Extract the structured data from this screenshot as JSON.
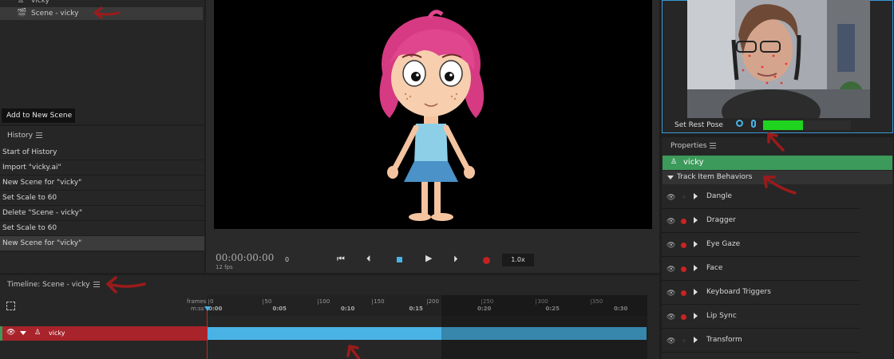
{
  "puppets": {
    "items": [
      {
        "label": "vicky"
      },
      {
        "label": "Scene - vicky"
      }
    ],
    "add_button": "Add to New Scene"
  },
  "history": {
    "title": "History",
    "items": [
      "Start of History",
      "Import \"vicky.ai\"",
      "New Scene for \"vicky\"",
      "Set Scale to 60",
      "Delete \"Scene - vicky\"",
      "Set Scale to 60",
      "New Scene for \"vicky\""
    ]
  },
  "transport": {
    "timecode": "00:00:00:00",
    "fps": "12 fps",
    "frame": "0",
    "speed": "1.0x"
  },
  "camera": {
    "set_rest_pose": "Set Rest Pose",
    "audio_level": 0.45
  },
  "properties": {
    "title": "Properties",
    "puppet_name": "vicky",
    "section": "Track Item Behaviors",
    "behaviors": [
      {
        "label": "Dangle",
        "armed": false
      },
      {
        "label": "Dragger",
        "armed": true
      },
      {
        "label": "Eye Gaze",
        "armed": true
      },
      {
        "label": "Face",
        "armed": true
      },
      {
        "label": "Keyboard Triggers",
        "armed": true
      },
      {
        "label": "Lip Sync",
        "armed": true
      },
      {
        "label": "Transform",
        "armed": false
      }
    ]
  },
  "timeline": {
    "title": "Timeline: Scene - vicky",
    "frames_label": "frames",
    "time_label": "m:ss",
    "frame_ticks": [
      "0",
      "50",
      "100",
      "150",
      "200",
      "250",
      "300",
      "350"
    ],
    "time_ticks": [
      "0:00",
      "0:05",
      "0:10",
      "0:15",
      "0:20",
      "0:25",
      "0:30"
    ],
    "track_name": "vicky"
  },
  "colors": {
    "accent_blue": "#4ab3e6",
    "record_red": "#c22222",
    "track_red": "#a8232a",
    "puppet_green": "#3c9a5a",
    "meter_green": "#1ed41e",
    "annotation_red": "#9b1b1b"
  }
}
